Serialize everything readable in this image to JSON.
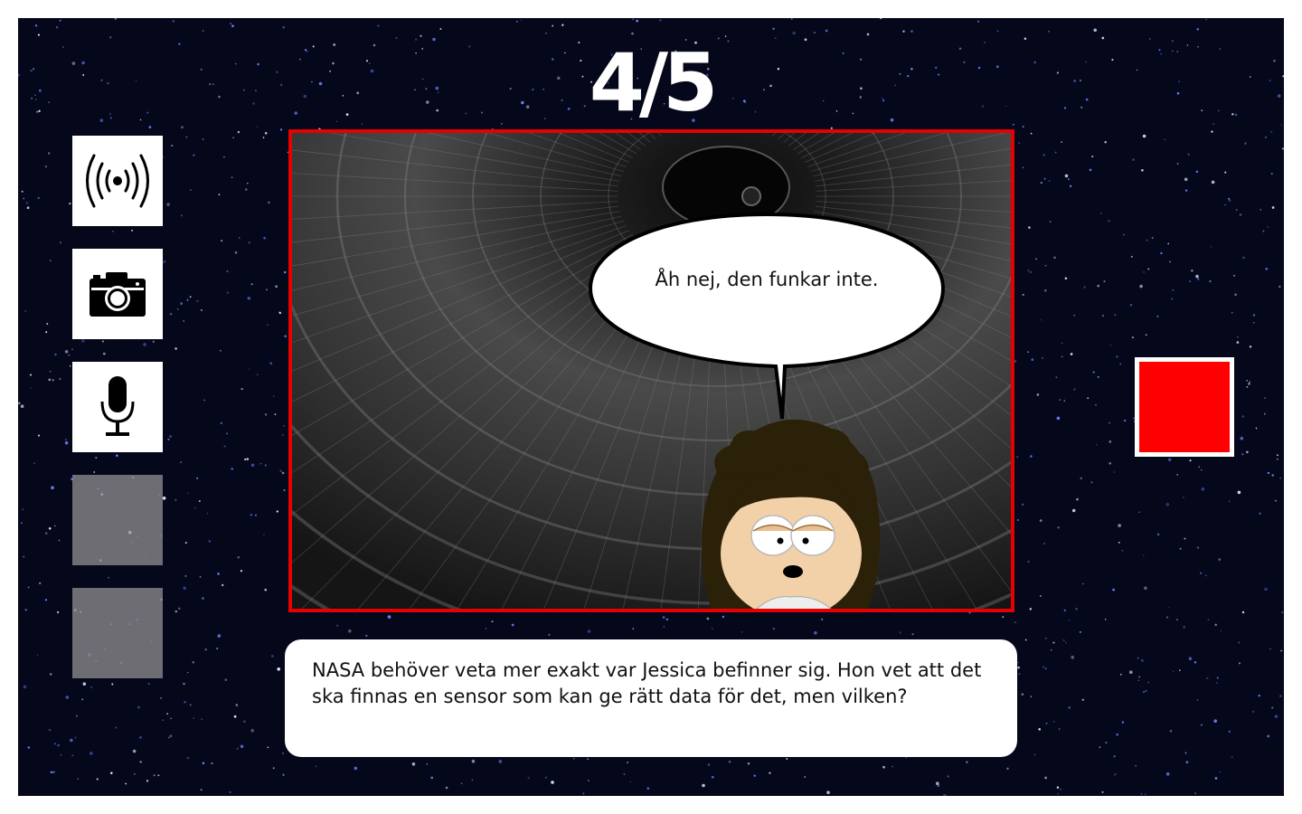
{
  "progress": {
    "label": "4/5",
    "current": 4,
    "total": 5
  },
  "toolbar": {
    "slots": [
      {
        "icon": "wireless-signal-icon",
        "state": "available"
      },
      {
        "icon": "camera-icon",
        "state": "available"
      },
      {
        "icon": "microphone-icon",
        "state": "available"
      },
      {
        "icon": "",
        "state": "empty"
      },
      {
        "icon": "",
        "state": "empty"
      }
    ]
  },
  "scene": {
    "background": "rocket-tunnel",
    "character": "jessica-avatar",
    "speech": "Åh nej, den funkar inte."
  },
  "narration": "NASA behöver veta mer exakt var Jessica befinner sig. Hon vet att det ska finnas en sensor som kan ge rätt data för det, men vilken?",
  "drop_target": {
    "icon": "red-square",
    "color": "#ff0000"
  },
  "colors": {
    "frame": "#e60000",
    "background": "#05071a",
    "panel": "#ffffff"
  }
}
